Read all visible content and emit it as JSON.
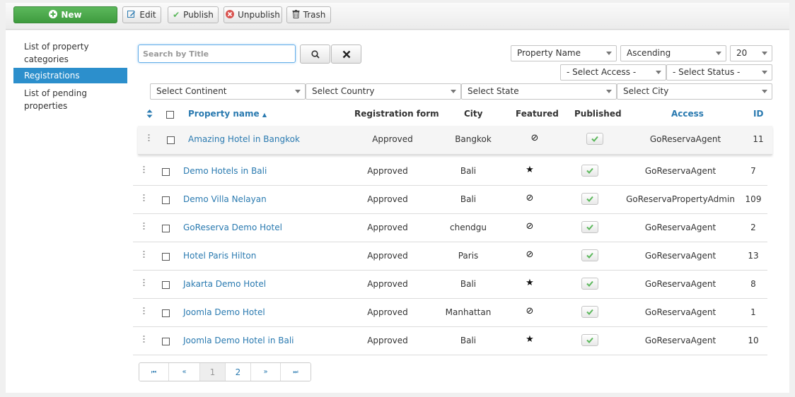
{
  "toolbar": {
    "new_label": "New",
    "edit_label": "Edit",
    "publish_label": "Publish",
    "unpublish_label": "Unpublish",
    "trash_label": "Trash"
  },
  "sidebar": {
    "items": [
      {
        "label": "List of property categories",
        "active": false
      },
      {
        "label": "Registrations",
        "active": true
      },
      {
        "label": "List of pending properties",
        "active": false
      }
    ]
  },
  "filters": {
    "search_placeholder": "Search by Title",
    "search_value": "",
    "sort_field": "Property Name",
    "sort_dir": "Ascending",
    "limit": "20",
    "access": "- Select Access -",
    "status": "- Select Status -",
    "continent": "Select Continent",
    "country": "Select Country",
    "state": "Select State",
    "city": "Select City"
  },
  "table": {
    "headers": {
      "name": "Property name",
      "form": "Registration form",
      "city": "City",
      "featured": "Featured",
      "published": "Published",
      "access": "Access",
      "id": "ID"
    },
    "rows": [
      {
        "name": "Amazing Hotel in Bangkok",
        "form": "Approved",
        "city": "Bangkok",
        "featured": false,
        "published": true,
        "access": "GoReservaAgent",
        "id": "11"
      },
      {
        "name": "Demo Hotels in Bali",
        "form": "Approved",
        "city": "Bali",
        "featured": true,
        "published": true,
        "access": "GoReservaAgent",
        "id": "7"
      },
      {
        "name": "Demo Villa Nelayan",
        "form": "Approved",
        "city": "Bali",
        "featured": false,
        "published": true,
        "access": "GoReservaPropertyAdmin",
        "id": "109"
      },
      {
        "name": "GoReserva Demo Hotel",
        "form": "Approved",
        "city": "chendgu",
        "featured": false,
        "published": true,
        "access": "GoReservaAgent",
        "id": "2"
      },
      {
        "name": "Hotel Paris Hilton",
        "form": "Approved",
        "city": "Paris",
        "featured": false,
        "published": true,
        "access": "GoReservaAgent",
        "id": "13"
      },
      {
        "name": "Jakarta Demo Hotel",
        "form": "Approved",
        "city": "Bali",
        "featured": true,
        "published": true,
        "access": "GoReservaAgent",
        "id": "8"
      },
      {
        "name": "Joomla Demo Hotel",
        "form": "Approved",
        "city": "Manhattan",
        "featured": false,
        "published": true,
        "access": "GoReservaAgent",
        "id": "1"
      },
      {
        "name": "Joomla Demo Hotel in Bali",
        "form": "Approved",
        "city": "Bali",
        "featured": true,
        "published": true,
        "access": "GoReservaAgent",
        "id": "10"
      }
    ]
  },
  "pagination": {
    "first": "⏮",
    "prev": "«",
    "pages": [
      "1",
      "2"
    ],
    "current": "1",
    "next": "»",
    "last": "⏭"
  },
  "colors": {
    "accent": "#2c8fcc",
    "link": "#2a7ab0",
    "new_button": "#4cae4c",
    "publish_check": "#5cb85c",
    "unpublish_x": "#d9534f"
  }
}
